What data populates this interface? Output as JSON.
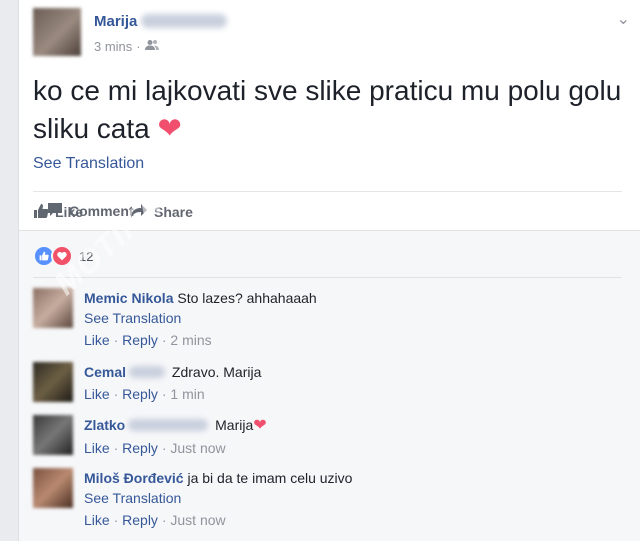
{
  "post": {
    "author": "Marija",
    "time": "3 mins",
    "separator": " · ",
    "text": "ko ce mi lajkovati sve slike praticu mu polu golu sliku cata",
    "see_translation": "See Translation"
  },
  "actions": {
    "like": "Like",
    "comment": "Comment",
    "share": "Share"
  },
  "reactions": {
    "count": "12"
  },
  "comments": [
    {
      "name": "Memic Nikola",
      "text": "Sto lazes? ahhahaaah",
      "see_translation": "See Translation",
      "like": "Like",
      "reply": "Reply",
      "time": "2 mins"
    },
    {
      "name": "Cemal",
      "text": "Zdravo. Marija",
      "like": "Like",
      "reply": "Reply",
      "time": "1 min"
    },
    {
      "name": "Zlatko",
      "text": "Marija",
      "like": "Like",
      "reply": "Reply",
      "time": "Just now"
    },
    {
      "name": "Miloš Đorđević",
      "text": "ja bi da te imam celu uzivo",
      "see_translation": "See Translation",
      "like": "Like",
      "reply": "Reply",
      "time": "Just now"
    }
  ],
  "watermark": "MOTIKA",
  "colors": {
    "link": "#365899",
    "muted": "#90949c",
    "like_blue": "#5890ff",
    "love_red": "#f25268"
  }
}
